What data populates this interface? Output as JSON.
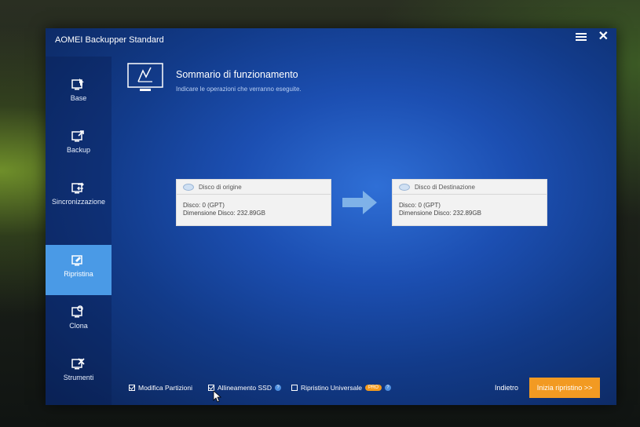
{
  "app": {
    "title": "AOMEI Backupper Standard"
  },
  "sidebar": {
    "items": [
      {
        "label": "Base",
        "icon": "home-icon",
        "active": false
      },
      {
        "label": "Backup",
        "icon": "backup-icon",
        "active": false
      },
      {
        "label": "Sincronizzazione",
        "icon": "sync-icon",
        "active": false
      },
      {
        "label": "Ripristina",
        "icon": "restore-icon",
        "active": true
      },
      {
        "label": "Clona",
        "icon": "clone-icon",
        "active": false
      },
      {
        "label": "Strumenti",
        "icon": "tools-icon",
        "active": false
      }
    ]
  },
  "header": {
    "title": "Sommario di funzionamento",
    "subtitle": "Indicare le operazioni che verranno eseguite."
  },
  "source_disk": {
    "heading": "Disco di origine",
    "disk_line": "Disco: 0 (GPT)",
    "size_line": "Dimensione Disco: 232.89GB"
  },
  "destination_disk": {
    "heading": "Disco di Destinazione",
    "disk_line": "Disco: 0 (GPT)",
    "size_line": "Dimensione Disco: 232.89GB"
  },
  "options": {
    "edit_partitions": {
      "label": "Modifica Partizioni",
      "checked": true
    },
    "ssd_alignment": {
      "label": "Allineamento SSD",
      "checked": true
    },
    "universal_restore": {
      "label": "Ripristino Universale",
      "checked": false,
      "badge": "PRO"
    }
  },
  "actions": {
    "back_label": "Indietro",
    "start_label": "Inizia ripristino >>"
  },
  "colors": {
    "accent": "#f29a22",
    "active_nav": "#4a9ae6",
    "window_bg": "#1c4fb2"
  }
}
